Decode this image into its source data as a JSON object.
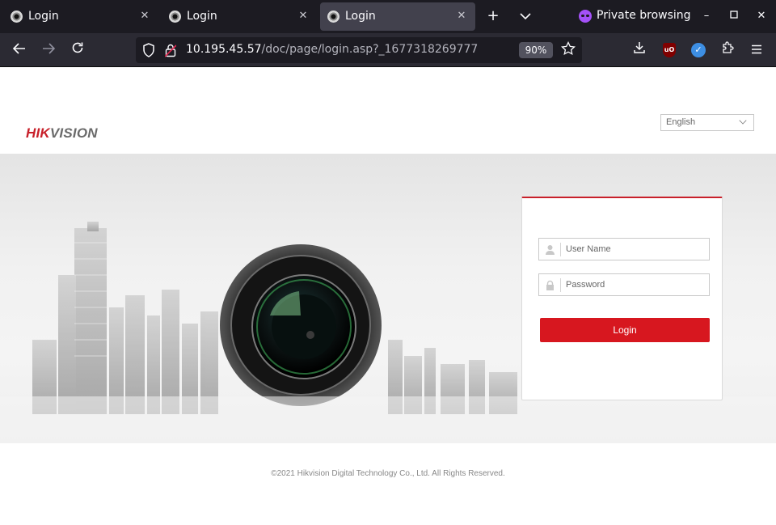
{
  "browser": {
    "tabs": [
      {
        "title": "Login",
        "active": false
      },
      {
        "title": "Login",
        "active": false
      },
      {
        "title": "Login",
        "active": true
      }
    ],
    "private_label": "Private browsing",
    "url_host": "10.195.45.57",
    "url_path": "/doc/page/login.asp?_1677318269777",
    "zoom": "90%",
    "icons": {
      "back": "arrow-left-icon",
      "forward": "arrow-right-icon",
      "reload": "reload-icon",
      "bookmark": "star-icon",
      "downloads": "download-icon",
      "ublock": "ublock-origin-icon",
      "extension": "extension-icon",
      "extensions": "puzzle-icon",
      "menu": "hamburger-menu-icon"
    }
  },
  "page": {
    "logo": {
      "part1": "HIK",
      "part2": "VISION"
    },
    "language": {
      "selected": "English"
    },
    "login": {
      "username_placeholder": "User Name",
      "password_placeholder": "Password",
      "button_label": "Login"
    },
    "footer": "©2021 Hikvision Digital Technology Co., Ltd. All Rights Reserved.",
    "colors": {
      "brand_red": "#d7171f",
      "logo_red": "#c8202a",
      "logo_gray": "#6b6b6b"
    }
  }
}
